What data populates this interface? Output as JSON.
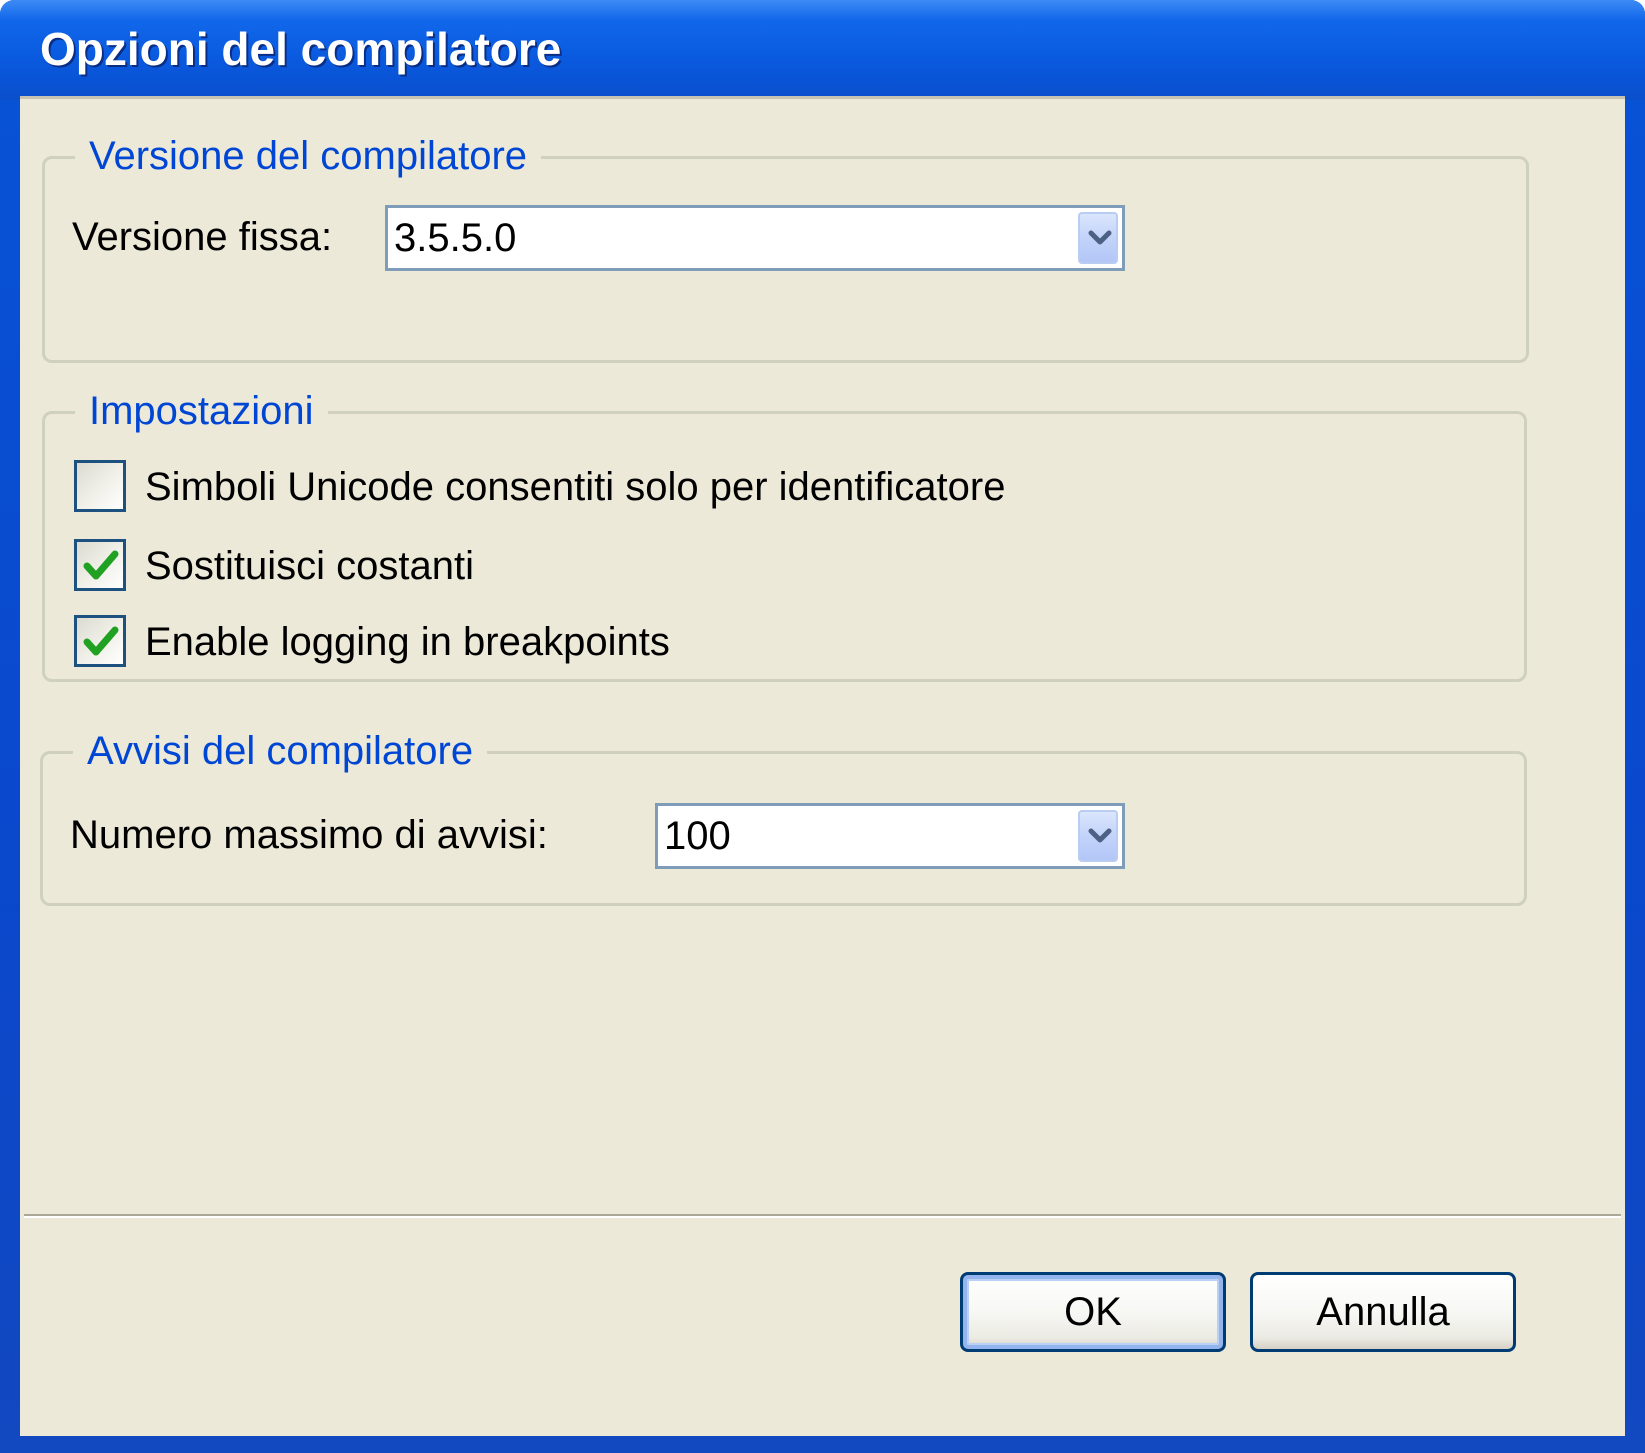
{
  "window": {
    "title": "Opzioni del compilatore"
  },
  "compiler_version_group": {
    "legend": "Versione del compilatore",
    "fixed_version_label": "Versione fissa:",
    "fixed_version_value": "3.5.5.0"
  },
  "settings_group": {
    "legend": "Impostazioni",
    "options": [
      {
        "label": "Simboli Unicode consentiti solo per identificatore",
        "checked": false
      },
      {
        "label": "Sostituisci costanti",
        "checked": true
      },
      {
        "label": "Enable logging in breakpoints",
        "checked": true
      }
    ]
  },
  "warnings_group": {
    "legend": "Avvisi del compilatore",
    "max_warnings_label": "Numero massimo di avvisi:",
    "max_warnings_value": "100"
  },
  "buttons": {
    "ok_label": "OK",
    "cancel_label": "Annulla"
  },
  "colors": {
    "titlebar": "#0a5be0",
    "client_bg": "#ece9d8",
    "group_legend": "#0046d5",
    "check_mark": "#21a121"
  },
  "icons": {
    "dropdown": "chevron-down-icon",
    "check": "checkmark-icon"
  }
}
